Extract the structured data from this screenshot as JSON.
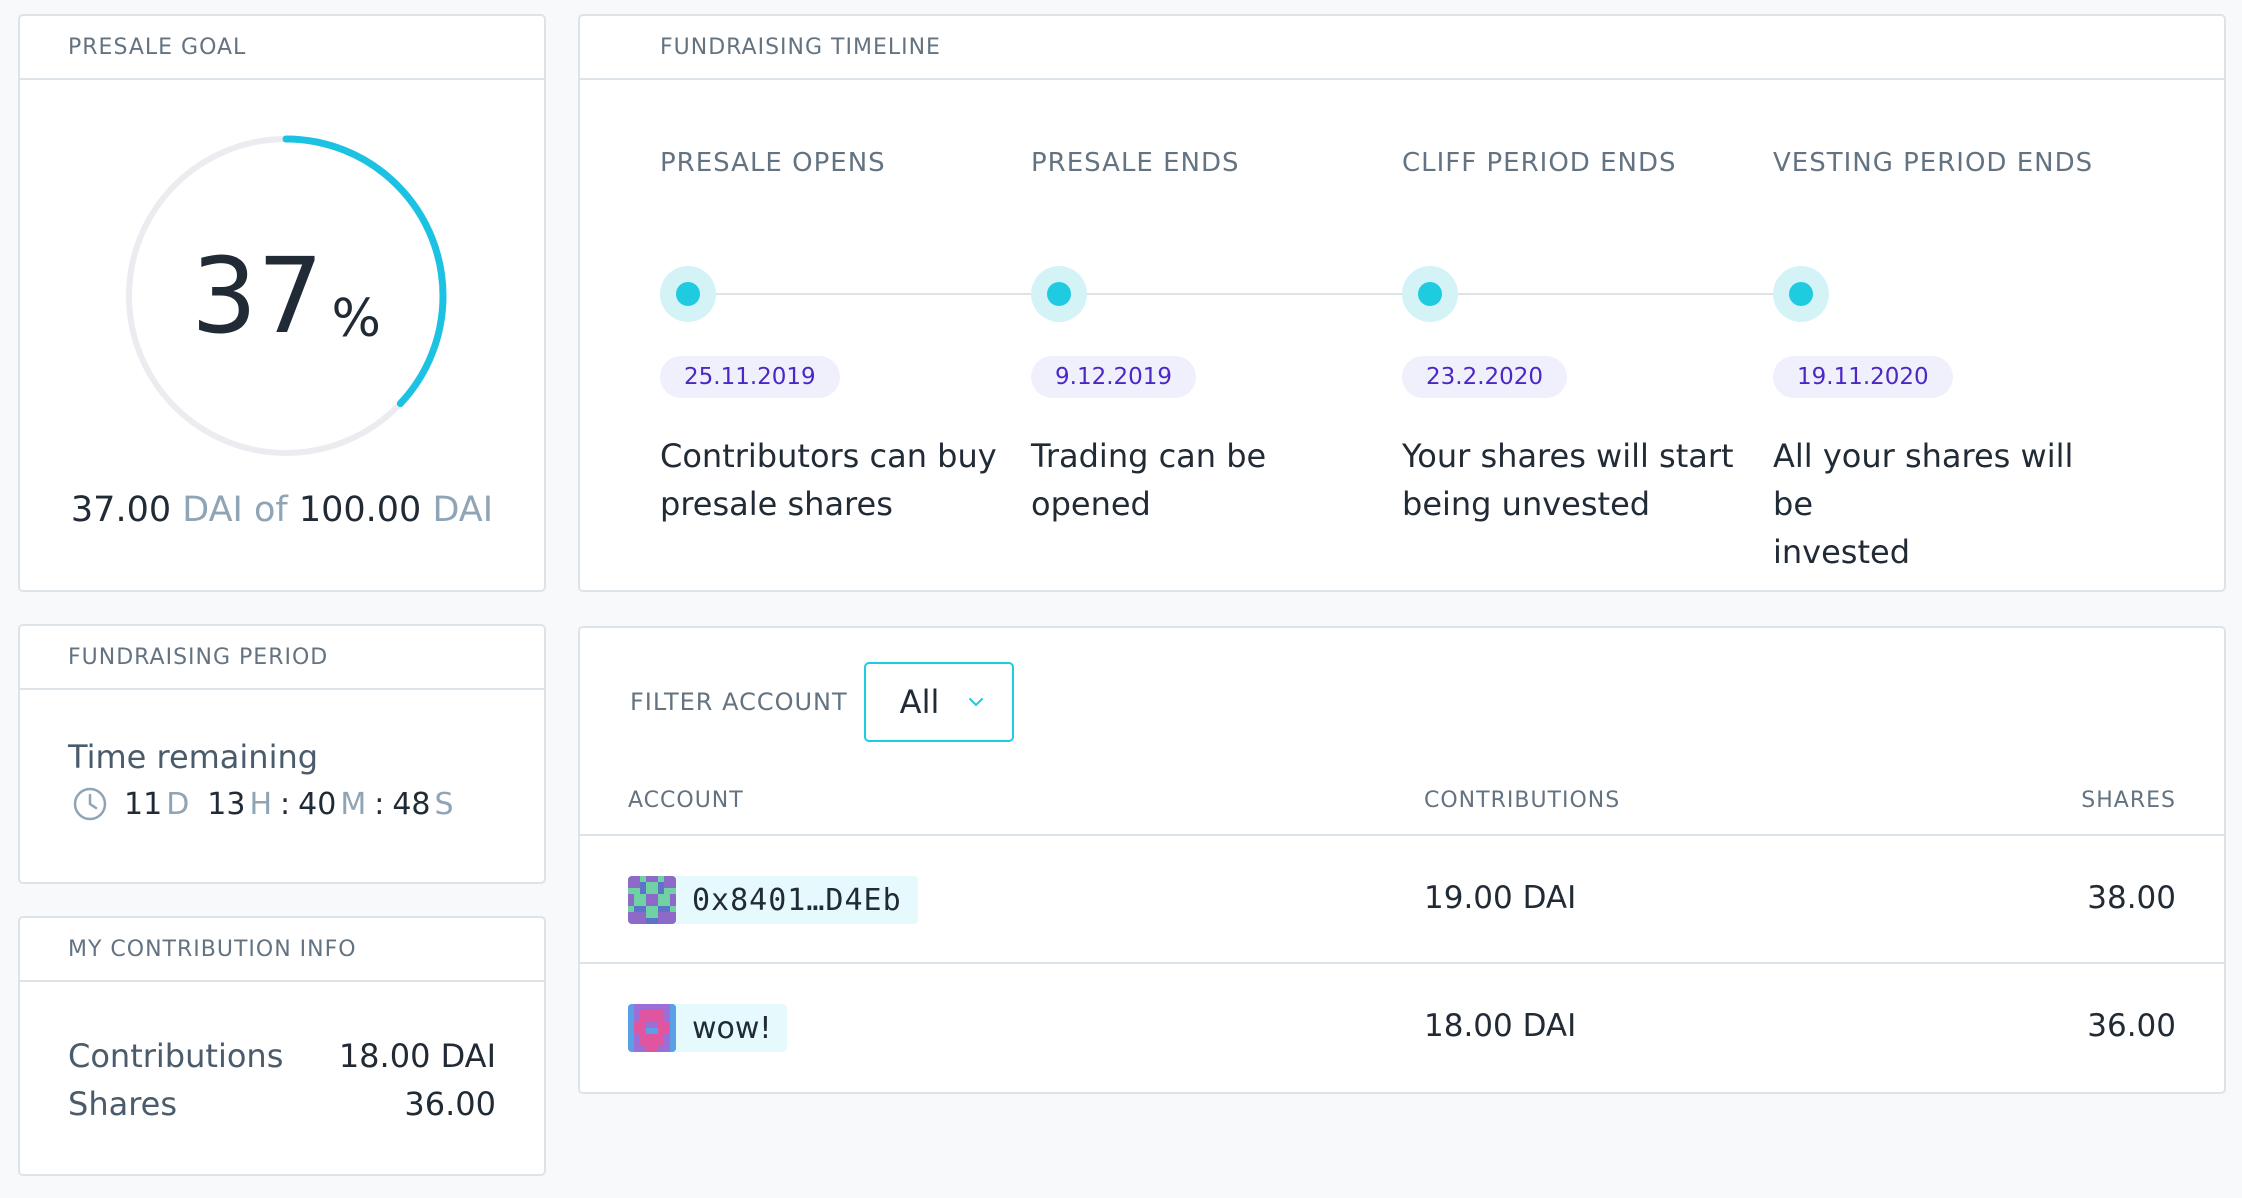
{
  "presale_goal": {
    "header": "PRESALE GOAL",
    "progress": 0.37,
    "percent": "37",
    "percent_sign": "%",
    "raised": "37.00",
    "raised_unit": "DAI of",
    "goal": "100.00",
    "goal_unit": "DAI",
    "ring_color": "#1cc2e2",
    "ring_track_color": "#eaecf0"
  },
  "fundraising_period": {
    "header": "FUNDRAISING PERIOD",
    "label": "Time remaining",
    "days": "11",
    "days_unit": "D",
    "hours": "13",
    "hours_unit": "H",
    "minutes": "40",
    "minutes_unit": "M",
    "seconds": "48",
    "seconds_unit": "S",
    "separator": ":",
    "icon": "clock-icon"
  },
  "my_contribution": {
    "header": "MY CONTRIBUTION INFO",
    "contributions_label": "Contributions",
    "contributions_value": "18.00 DAI",
    "shares_label": "Shares",
    "shares_value": "36.00"
  },
  "timeline": {
    "header": "FUNDRAISING TIMELINE",
    "steps": [
      {
        "title": "PRESALE OPENS",
        "date": "25.11.2019",
        "line1": "Contributors can buy",
        "line2": "presale shares"
      },
      {
        "title": "PRESALE ENDS",
        "date": "9.12.2019",
        "line1": "Trading can be opened",
        "line2": ""
      },
      {
        "title": "CLIFF PERIOD ENDS",
        "date": "23.2.2020",
        "line1": "Your shares will start",
        "line2": "being unvested"
      },
      {
        "title": "VESTING PERIOD ENDS",
        "date": "19.11.2020",
        "line1": "All your shares will be",
        "line2": "invested"
      }
    ],
    "dot_color": "#1ecbe1",
    "date_color": "#4b27c5"
  },
  "contributions_table": {
    "filter_label": "FILTER ACCOUNT",
    "filter_value": "All",
    "columns": [
      "ACCOUNT",
      "CONTRIBUTIONS",
      "SHARES"
    ],
    "rows": [
      {
        "account": "0x8401…D4Eb",
        "contributions": "19.00 DAI",
        "shares": "38.00"
      },
      {
        "account": "wow!",
        "contributions": "18.00 DAI",
        "shares": "36.00"
      }
    ]
  }
}
